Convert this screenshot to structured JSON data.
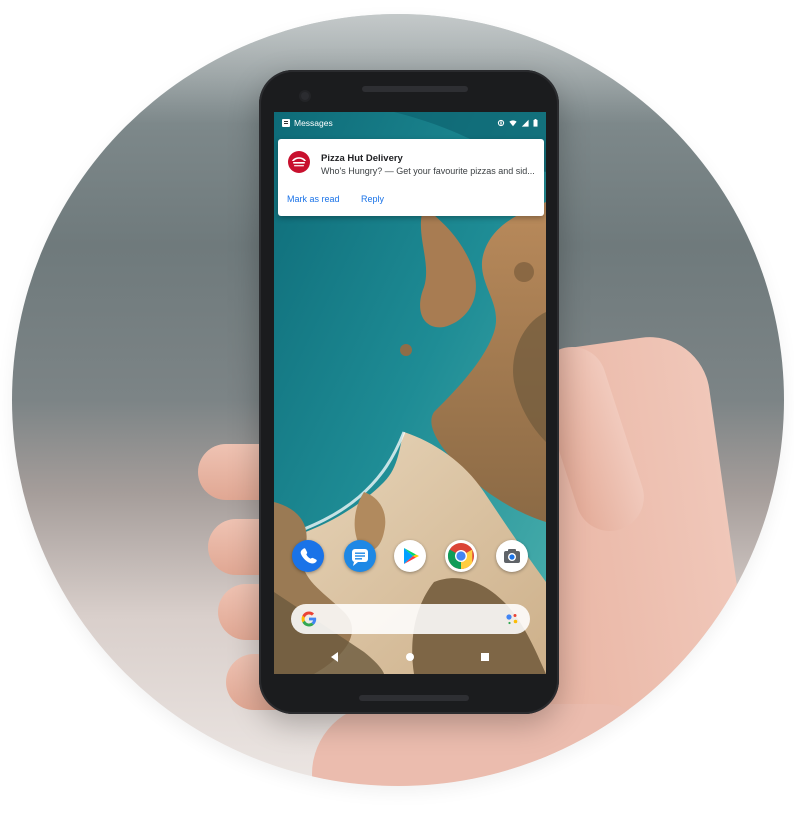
{
  "status_bar": {
    "app_label": "Messages"
  },
  "notification": {
    "app_icon": "pizza-hut-logo",
    "title": "Pizza Hut Delivery",
    "body": "Who's Hungry? — Get your favourite pizzas and sid...",
    "actions": [
      {
        "label": "Mark as read"
      },
      {
        "label": "Reply"
      }
    ]
  },
  "dock": {
    "apps": [
      {
        "icon": "phone-icon",
        "color": "#1a73e8"
      },
      {
        "icon": "messages-icon",
        "color": "#1e88e5"
      },
      {
        "icon": "play-store-icon",
        "color": "#ffffff"
      },
      {
        "icon": "chrome-icon",
        "color": "#ffffff"
      },
      {
        "icon": "camera-icon",
        "color": "#ffffff"
      }
    ]
  },
  "search": {
    "logo": "google-g-icon",
    "assistant": "google-assistant-icon"
  },
  "nav": {
    "buttons": [
      "back-icon",
      "home-icon",
      "recents-icon"
    ]
  },
  "colors": {
    "notification_action": "#1a73e8",
    "brand_red": "#c8102e"
  }
}
